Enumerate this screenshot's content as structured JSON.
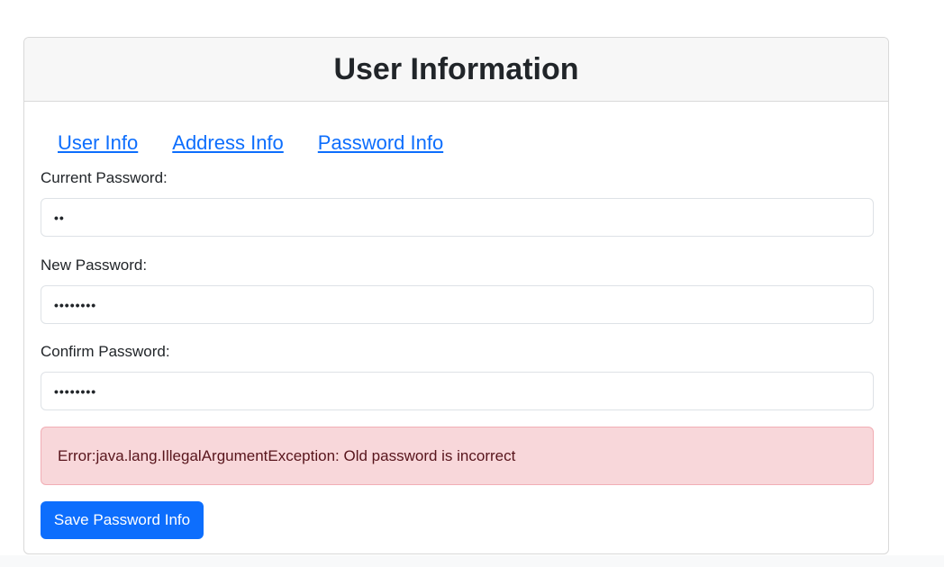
{
  "header": {
    "title": "User Information"
  },
  "tabs": [
    {
      "label": "User Info"
    },
    {
      "label": "Address Info"
    },
    {
      "label": "Password Info"
    }
  ],
  "form": {
    "current_password": {
      "label": "Current Password:",
      "masked_value": "••"
    },
    "new_password": {
      "label": "New Password:",
      "masked_value": "••••••••"
    },
    "confirm_password": {
      "label": "Confirm Password:",
      "masked_value": "••••••••"
    },
    "error_message": "Error:java.lang.IllegalArgumentException: Old password is incorrect",
    "save_label": "Save Password Info"
  },
  "colors": {
    "accent": "#0d6efd",
    "alert_bg": "#f8d7da",
    "alert_text": "#58151c"
  }
}
